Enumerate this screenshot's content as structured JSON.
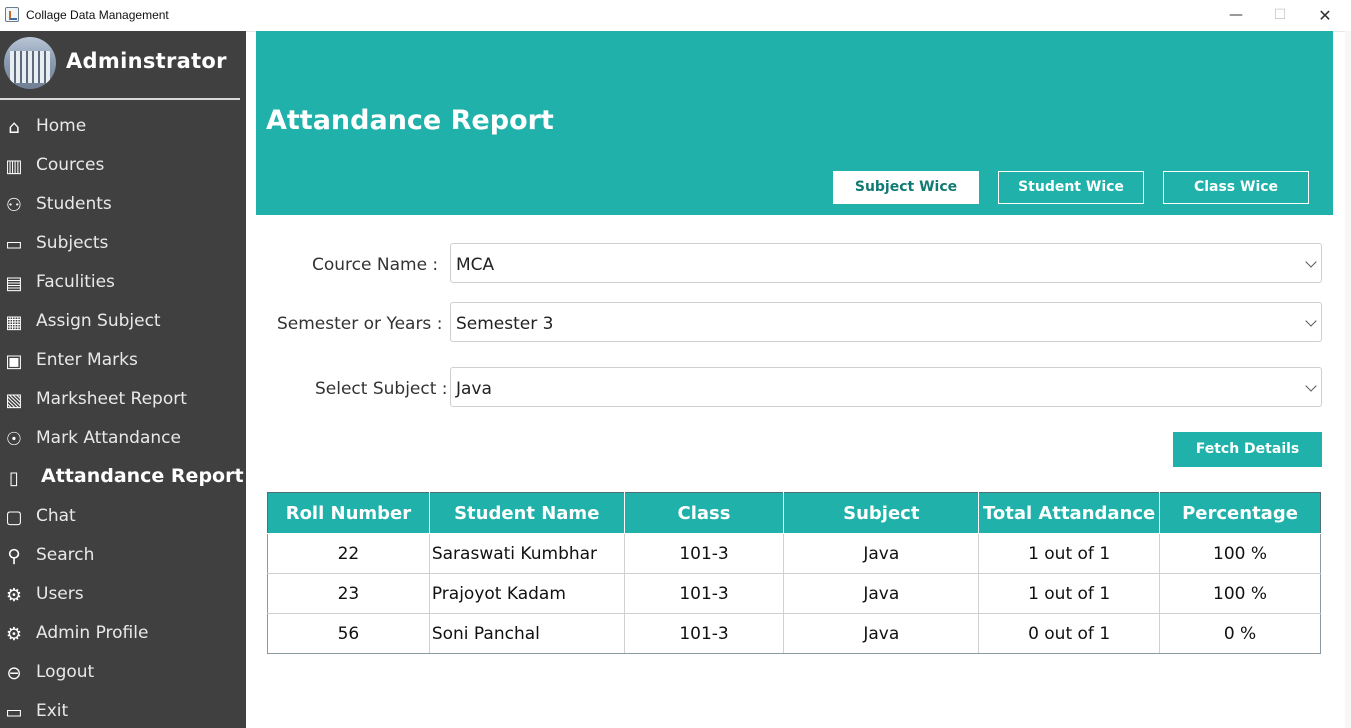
{
  "window": {
    "title": "Collage Data Management",
    "controls": {
      "minimize": "—",
      "maximize": "☐",
      "close": "✕"
    }
  },
  "sidebar": {
    "admin_title": "Adminstrator",
    "items": [
      {
        "label": "Home",
        "icon": "home-icon",
        "glyph": "⌂"
      },
      {
        "label": "Cources",
        "icon": "books-icon",
        "glyph": "▥"
      },
      {
        "label": "Students",
        "icon": "student-add-icon",
        "glyph": "⚇"
      },
      {
        "label": "Subjects",
        "icon": "open-book-icon",
        "glyph": "▭"
      },
      {
        "label": "Faculities",
        "icon": "id-card-icon",
        "glyph": "▤"
      },
      {
        "label": "Assign Subject",
        "icon": "assign-icon",
        "glyph": "▦"
      },
      {
        "label": "Enter Marks",
        "icon": "marks-icon",
        "glyph": "▣"
      },
      {
        "label": "Marksheet Report",
        "icon": "report-doc-icon",
        "glyph": "▧"
      },
      {
        "label": "Mark Attandance",
        "icon": "user-check-icon",
        "glyph": "☉"
      },
      {
        "label": "Attandance Report",
        "icon": "doc-clock-icon",
        "glyph": "▯"
      },
      {
        "label": "Chat",
        "icon": "chat-icon",
        "glyph": "▢"
      },
      {
        "label": "Search",
        "icon": "user-search-icon",
        "glyph": "⚲"
      },
      {
        "label": "Users",
        "icon": "users-gear-icon",
        "glyph": "⚙"
      },
      {
        "label": "Admin Profile",
        "icon": "admin-gear-icon",
        "glyph": "⚙"
      },
      {
        "label": "Logout",
        "icon": "logout-icon",
        "glyph": "⊖"
      },
      {
        "label": "Exit",
        "icon": "exit-icon",
        "glyph": "▭"
      }
    ],
    "active_index": 9
  },
  "header": {
    "title": "Attandance Report",
    "tabs": [
      {
        "label": "Subject Wice",
        "active": true
      },
      {
        "label": "Student Wice",
        "active": false
      },
      {
        "label": "Class Wice",
        "active": false
      }
    ]
  },
  "form": {
    "course": {
      "label": "Cource Name  :",
      "value": "MCA"
    },
    "semester": {
      "label": "Semester or Years  :",
      "value": "Semester 3"
    },
    "subject": {
      "label": "Select Subject  :",
      "value": "Java"
    },
    "fetch_label": "Fetch Details"
  },
  "table": {
    "columns": [
      "Roll Number",
      "Student Name",
      "Class",
      "Subject",
      "Total Attandance",
      "Percentage"
    ],
    "rows": [
      [
        "22",
        "Saraswati Kumbhar",
        "101-3",
        "Java",
        "1 out of 1",
        "100 %"
      ],
      [
        "23",
        "Prajoyot Kadam",
        "101-3",
        "Java",
        "1 out of 1",
        "100 %"
      ],
      [
        "56",
        "Soni Panchal",
        "101-3",
        "Java",
        "0 out of 1",
        "0 %"
      ]
    ]
  },
  "colors": {
    "accent": "#20b2aa",
    "sidebar_bg": "#404040",
    "tab_active_text": "#127a74"
  }
}
